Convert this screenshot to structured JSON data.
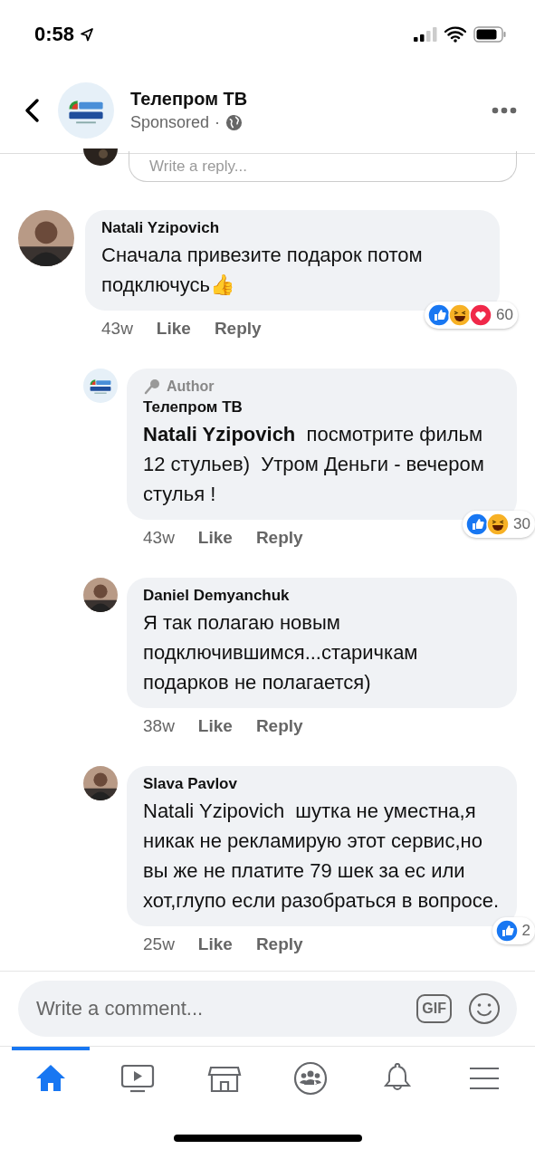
{
  "status_bar": {
    "time": "0:58"
  },
  "header": {
    "title": "Телепром ТВ",
    "subtitle": "Sponsored",
    "separator": "·"
  },
  "reply_field": {
    "placeholder": "Write a reply..."
  },
  "comments": [
    {
      "kind": "top",
      "avatar": {
        "kind": "picture"
      },
      "author": "Natali Yzipovich",
      "text": "Сначала привезите подарок потом подключусь👍",
      "time": "43w",
      "like": "Like",
      "reply": "Reply",
      "reactions": [
        {
          "kind": "like"
        },
        {
          "kind": "haha"
        },
        {
          "kind": "love"
        }
      ],
      "reaction_count": "60"
    },
    {
      "kind": "reply",
      "avatar": {
        "kind": "logo"
      },
      "author": "Телепром ТВ",
      "author_badge": "Author",
      "text": "**Natali Yzipovich**  посмотрите фильм 12 стульев)  Утром Деньги - вечером стулья !",
      "time": "43w",
      "like": "Like",
      "reply": "Reply",
      "reactions": [
        {
          "kind": "like"
        },
        {
          "kind": "haha"
        }
      ],
      "reaction_count": "30"
    },
    {
      "kind": "reply",
      "avatar": {
        "kind": "picture"
      },
      "author": "Daniel Demyanchuk",
      "text": "Я так полагаю новым подключившимся...старичкам подарков не полагается)",
      "time": "38w",
      "like": "Like",
      "reply": "Reply"
    },
    {
      "kind": "reply",
      "avatar": {
        "kind": "picture"
      },
      "author": "Slava Pavlov",
      "text": "Natali Yzipovich  шутка не уместна,я никак не рекламирую этот сервис,но вы же не платите 79 шек за ес или хот,глупо если разобраться в вопросе.",
      "time": "25w",
      "like": "Like",
      "reply": "Reply",
      "reactions": [
        {
          "kind": "like"
        }
      ],
      "reaction_count": "2"
    }
  ],
  "composer": {
    "placeholder": "Write a comment...",
    "gif": "GIF"
  },
  "nav": [
    {
      "kind": "home",
      "selected": true
    },
    {
      "kind": "watch",
      "selected": false
    },
    {
      "kind": "marketplace",
      "selected": false
    },
    {
      "kind": "groups",
      "selected": false
    },
    {
      "kind": "notifications",
      "selected": false
    },
    {
      "kind": "menu",
      "selected": false
    }
  ]
}
